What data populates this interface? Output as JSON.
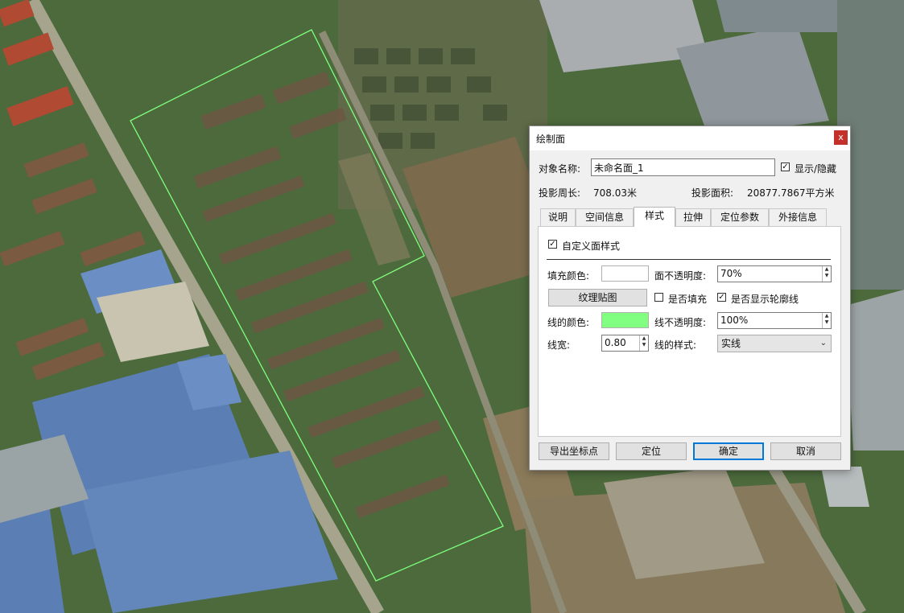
{
  "dialog": {
    "title": "绘制面",
    "close_label": "x",
    "name_label": "对象名称:",
    "name_value": "未命名面_1",
    "show_hide_label": "显示/隐藏",
    "perimeter_label": "投影周长:",
    "perimeter_value": "708.03米",
    "area_label": "投影面积:",
    "area_value": "20877.7867平方米",
    "tabs": [
      {
        "label": "说明"
      },
      {
        "label": "空间信息"
      },
      {
        "label": "样式"
      },
      {
        "label": "拉伸"
      },
      {
        "label": "定位参数"
      },
      {
        "label": "外接信息"
      }
    ],
    "style": {
      "custom_style_label": "自定义面样式",
      "fill_color_label": "填充颜色:",
      "fill_color": "#ffffff",
      "fill_opacity_label": "面不透明度:",
      "fill_opacity_value": "70%",
      "texture_button": "纹理贴图",
      "fill_check_label": "是否填充",
      "outline_check_label": "是否显示轮廓线",
      "line_color_label": "线的颜色:",
      "line_color": "#80ff80",
      "line_opacity_label": "线不透明度:",
      "line_opacity_value": "100%",
      "line_width_label": "线宽:",
      "line_width_value": "0.80",
      "line_style_label": "线的样式:",
      "line_style_value": "实线"
    },
    "buttons": {
      "export": "导出坐标点",
      "locate": "定位",
      "ok": "确定",
      "cancel": "取消"
    }
  },
  "polygon_color": "#7dff7d"
}
